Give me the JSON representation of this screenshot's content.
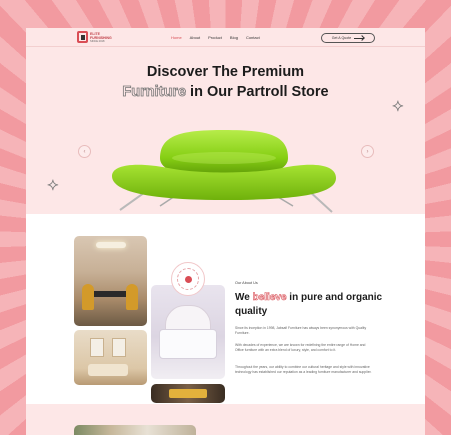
{
  "header": {
    "logo_line1": "ELITE",
    "logo_line2": "FURNISHING",
    "logo_sub": "SINCE 2018",
    "nav": [
      "Home",
      "About",
      "Product",
      "Blog",
      "Contact"
    ],
    "active_nav": "Home",
    "cta_label": "Get A Quote"
  },
  "hero": {
    "title_line1": "Discover The Premium",
    "title_outline_word": "Furniture",
    "title_line2_rest": " in Our Partroll Store",
    "prev_icon": "chevron-left-icon",
    "next_icon": "chevron-right-icon",
    "sofa_color": "#8cd11b"
  },
  "about": {
    "eyebrow": "Our About Us",
    "title_pre": "We ",
    "title_outline_word": "believe",
    "title_post": " in pure and organic quality",
    "paragraph1": "Since its inception in 1998, Jabsafi Furniture has always been synonymous with Quality Furniture.",
    "paragraph2": "With decades of experience, we are known for redefining the entire range of Home and Office furniture with an extra blend of luxury, style, and comfort to it.",
    "paragraph3": "Throughout the years, our ability to combine our cultural heritage and style with innovative technology has established our reputation as a leading furniture manufacturer and supplier."
  },
  "colors": {
    "accent": "#d94d55",
    "hero_bg": "#fde7e7",
    "background_stripe_a": "#f29aa0",
    "background_stripe_b": "#f6b4b8"
  }
}
